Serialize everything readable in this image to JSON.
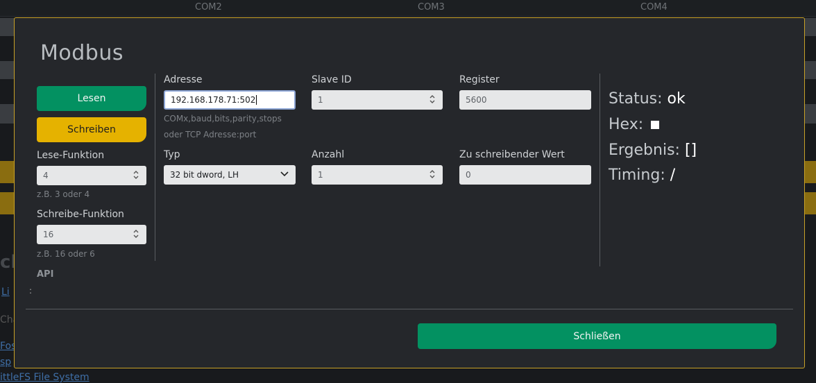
{
  "background": {
    "tabs": [
      "COM2",
      "COM3",
      "COM4"
    ],
    "heading_fragment": "ch",
    "api_colon": ":",
    "link_fragment": "Li",
    "text_fragment": "Cha",
    "link2": "Fos",
    "link3": "sp",
    "link4": "ittleFS File System"
  },
  "modal": {
    "title": "Modbus",
    "read_button": "Lesen",
    "write_button": "Schreiben",
    "read_function": {
      "label": "Lese-Funktion",
      "value": "4",
      "hint": "z.B. 3 oder 4"
    },
    "write_function": {
      "label": "Schreibe-Funktion",
      "value": "16",
      "hint": "z.B. 16 oder 6"
    },
    "api_label": "API",
    "address": {
      "label": "Adresse",
      "value": "192.168.178.71:502",
      "hint_line1": "COMx,baud,bits,parity,stops",
      "hint_line2": "oder TCP Adresse:port"
    },
    "slave_id": {
      "label": "Slave ID",
      "value": "1"
    },
    "register": {
      "label": "Register",
      "value": "5600"
    },
    "type": {
      "label": "Typ",
      "value": "32 bit dword, LH"
    },
    "count": {
      "label": "Anzahl",
      "value": "1"
    },
    "write_value": {
      "label": "Zu schreibender Wert",
      "value": "0"
    },
    "status": {
      "label": "Status:",
      "value": "ok"
    },
    "hex": {
      "label": "Hex:"
    },
    "result": {
      "label": "Ergebnis:",
      "value": "[]"
    },
    "timing": {
      "label": "Timing:",
      "value": "/"
    },
    "close_button": "Schließen"
  },
  "colors": {
    "accent_green": "#039161",
    "accent_yellow": "#e5b200",
    "modal_border": "#c9a227"
  }
}
